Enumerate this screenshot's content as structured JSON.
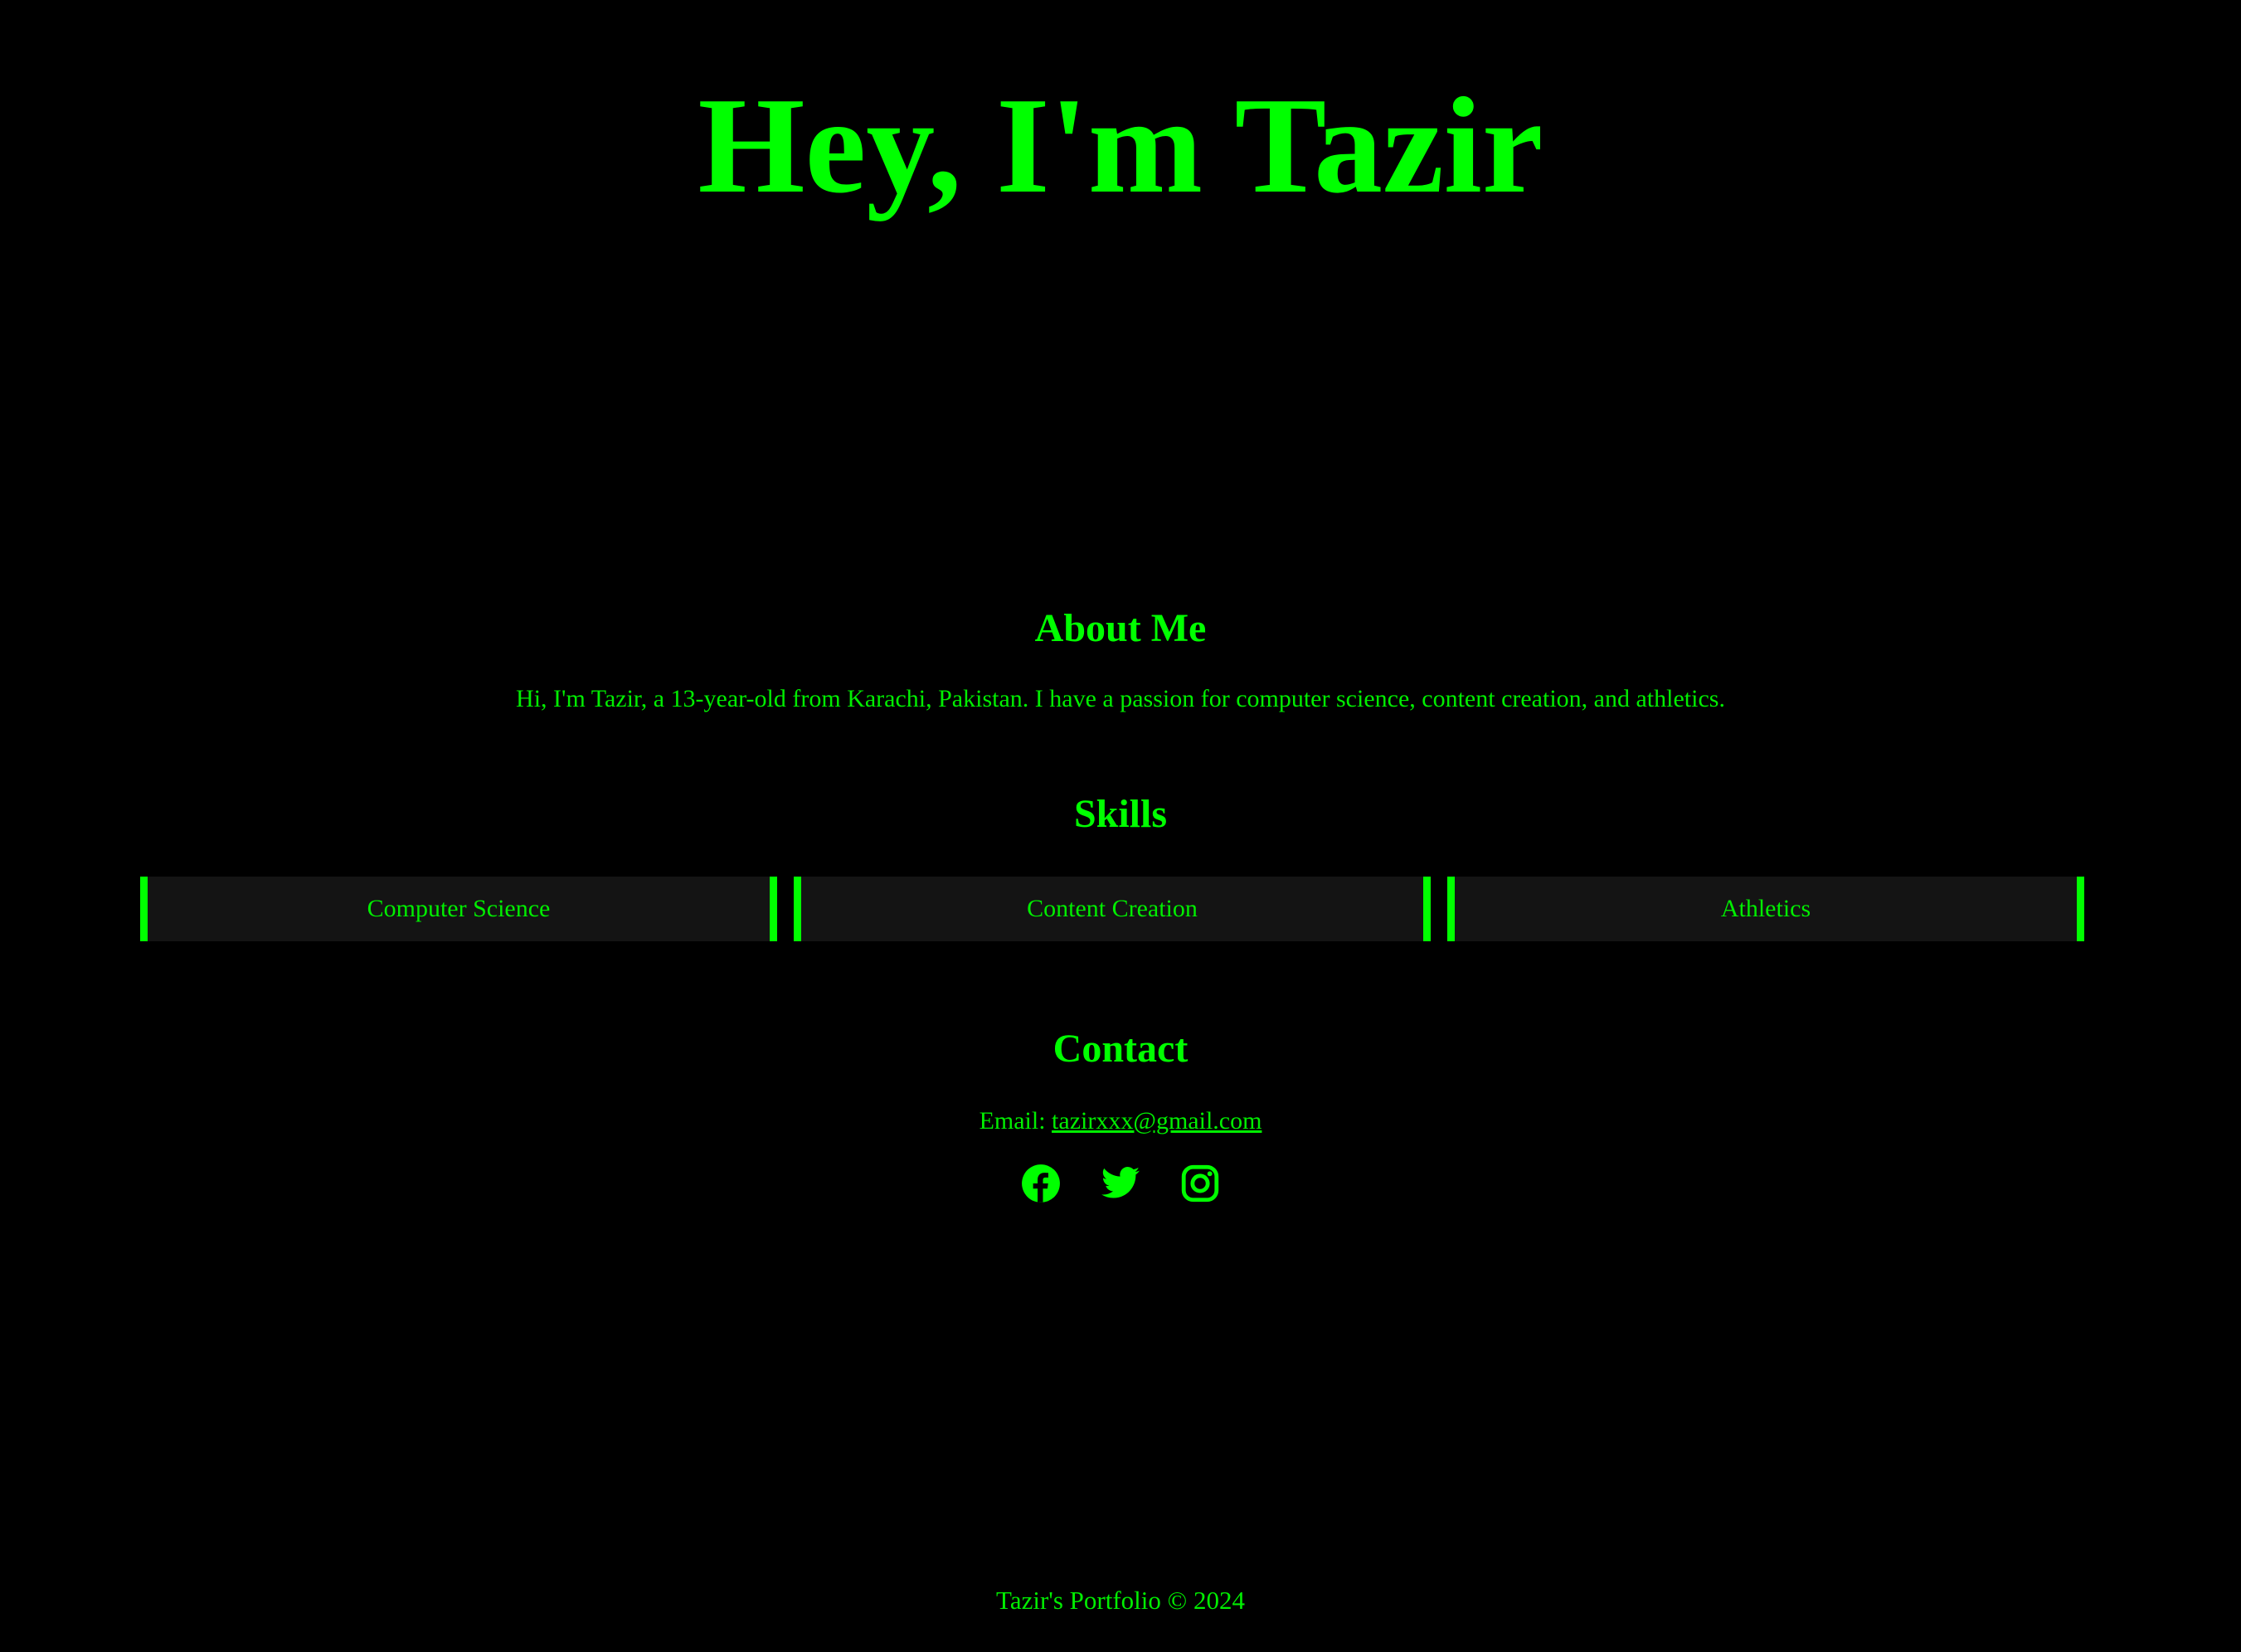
{
  "hero": {
    "title": "Hey, I'm Tazir"
  },
  "about": {
    "heading": "About Me",
    "text": "Hi, I'm Tazir, a 13-year-old from Karachi, Pakistan. I have a passion for computer science, content creation, and athletics."
  },
  "skills": {
    "heading": "Skills",
    "items": [
      {
        "label": "Computer Science"
      },
      {
        "label": "Content Creation"
      },
      {
        "label": "Athletics"
      }
    ]
  },
  "contact": {
    "heading": "Contact",
    "email_label": "Email:",
    "email": "tazirxxx@gmail.com",
    "social": [
      {
        "icon": "facebook-icon"
      },
      {
        "icon": "twitter-icon"
      },
      {
        "icon": "instagram-icon"
      }
    ]
  },
  "footer": {
    "text": "Tazir's Portfolio © 2024"
  },
  "colors": {
    "background": "#000000",
    "accent": "#00ff00",
    "card_background": "#141414"
  }
}
